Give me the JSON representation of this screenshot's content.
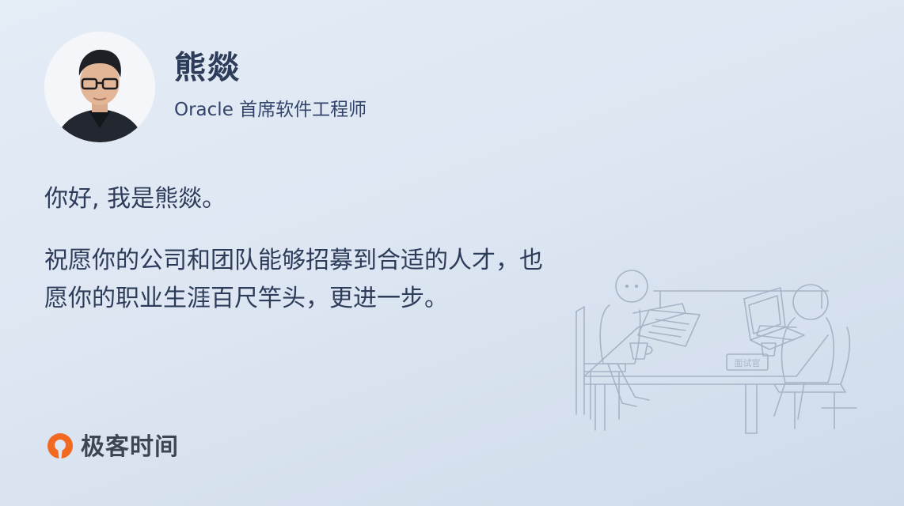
{
  "profile": {
    "name": "熊燚",
    "title": "Oracle 首席软件工程师"
  },
  "content": {
    "greeting": "你好, 我是熊燚。",
    "message": "祝愿你的公司和团队能够招募到合适的人才，也愿你的职业生涯百尺竿头，更进一步。"
  },
  "illustration": {
    "sign_label": "面试官"
  },
  "brand": {
    "name": "极客时间",
    "logo_icon": "geektime-logo-icon",
    "accent_color": "#f26a21"
  },
  "colors": {
    "text": "#2d3c59",
    "background": "#dde6f2",
    "line_art": "#a7b4c6"
  }
}
